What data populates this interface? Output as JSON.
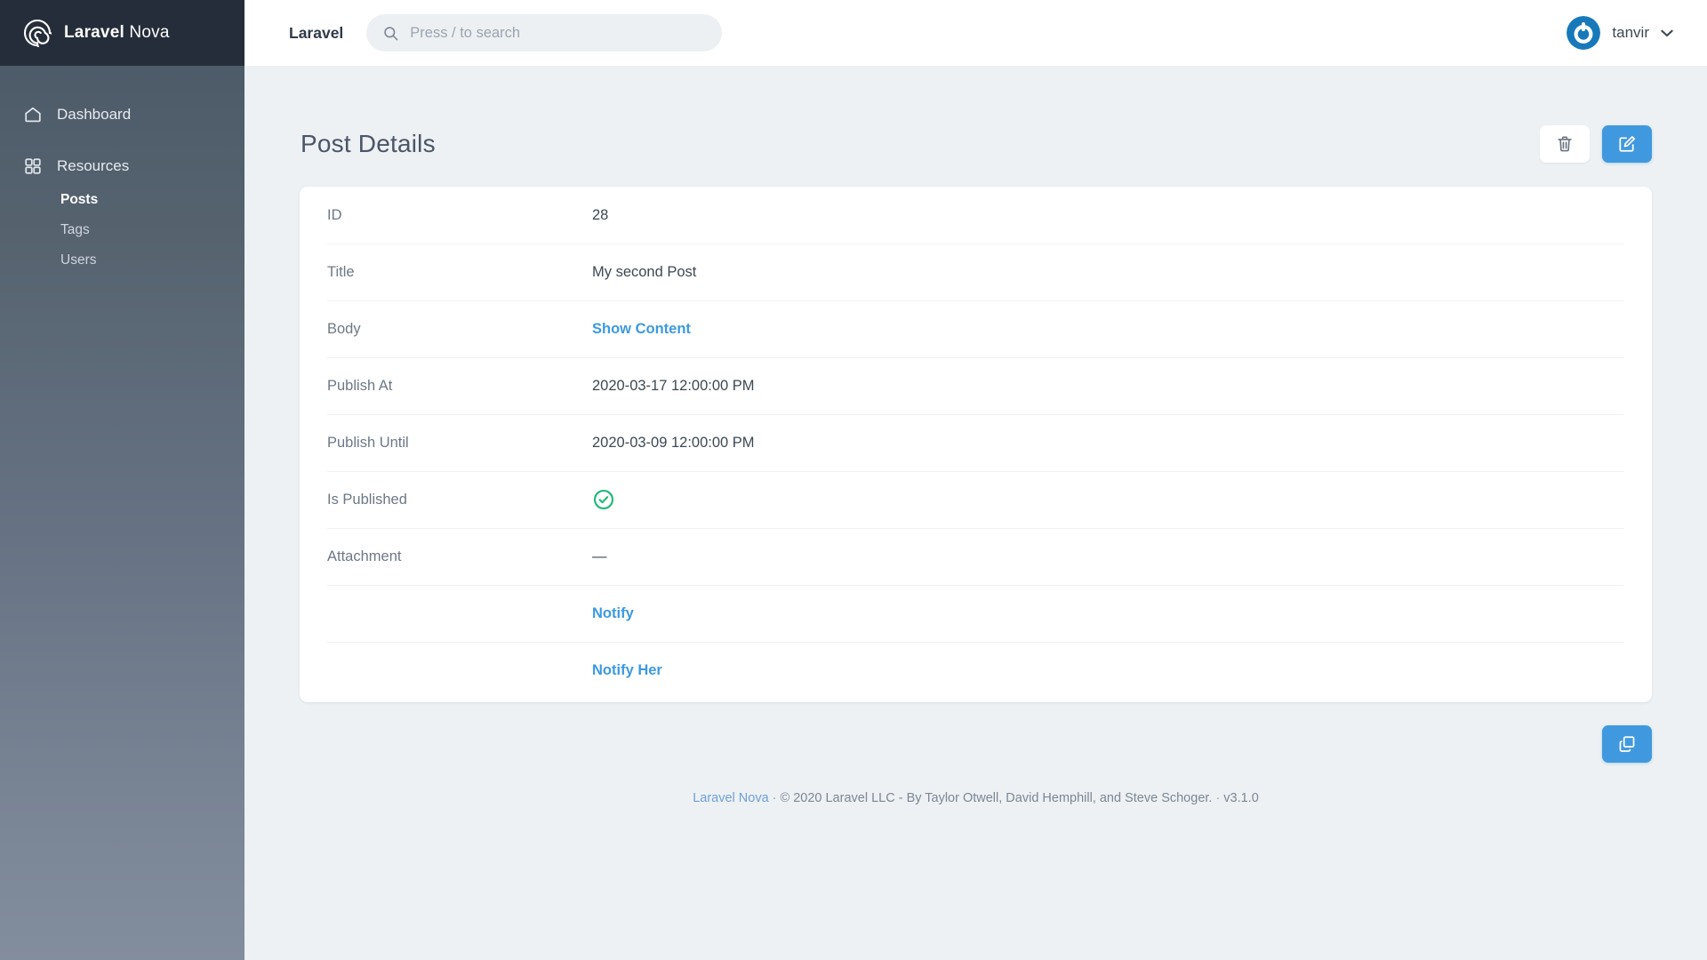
{
  "sidebar": {
    "logo_icon": "laravel-nova-spiral-icon",
    "logo_bold": "Laravel",
    "logo_light": " Nova",
    "items": [
      {
        "label": "Dashboard",
        "icon": "home-icon"
      },
      {
        "label": "Resources",
        "icon": "grid-icon"
      }
    ],
    "resources": [
      {
        "label": "Posts",
        "active": true
      },
      {
        "label": "Tags",
        "active": false
      },
      {
        "label": "Users",
        "active": false
      }
    ]
  },
  "topbar": {
    "brand": "Laravel",
    "search": {
      "placeholder": "Press / to search",
      "value": "",
      "icon": "search-icon"
    },
    "user": {
      "name": "tanvir",
      "avatar_icon": "user-avatar-icon",
      "chevron_icon": "chevron-down-icon"
    }
  },
  "page": {
    "title": "Post Details",
    "actions": [
      {
        "name": "delete",
        "icon": "trash-icon",
        "style": "light"
      },
      {
        "name": "edit",
        "icon": "edit-pencil-icon",
        "style": "primary"
      }
    ],
    "fields": [
      {
        "label": "ID",
        "value": "28",
        "type": "text"
      },
      {
        "label": "Title",
        "value": "My second Post",
        "type": "text"
      },
      {
        "label": "Body",
        "value": "Show Content",
        "type": "link"
      },
      {
        "label": "Publish At",
        "value": "2020-03-17 12:00:00 PM",
        "type": "text"
      },
      {
        "label": "Publish Until",
        "value": "2020-03-09 12:00:00 PM",
        "type": "text"
      },
      {
        "label": "Is Published",
        "value": "",
        "type": "boolean-true",
        "icon": "check-circle-icon"
      },
      {
        "label": "Attachment",
        "value": "—",
        "type": "text"
      },
      {
        "label": "",
        "value": "Notify",
        "type": "link"
      },
      {
        "label": "",
        "value": "Notify Her",
        "type": "link"
      }
    ],
    "duplicate_button": {
      "icon": "copy-icon"
    }
  },
  "footer": {
    "link": "Laravel Nova",
    "sep1": "·",
    "copyright": "© 2020 Laravel LLC - By Taylor Otwell, David Hemphill, and Steve Schoger.",
    "sep2": "·",
    "version": "v3.1.0"
  },
  "colors": {
    "accent": "#4099de",
    "link": "#3c9ae0",
    "success": "#21b978",
    "sidebar_header": "#252d3a",
    "page_bg": "#edf1f4"
  }
}
